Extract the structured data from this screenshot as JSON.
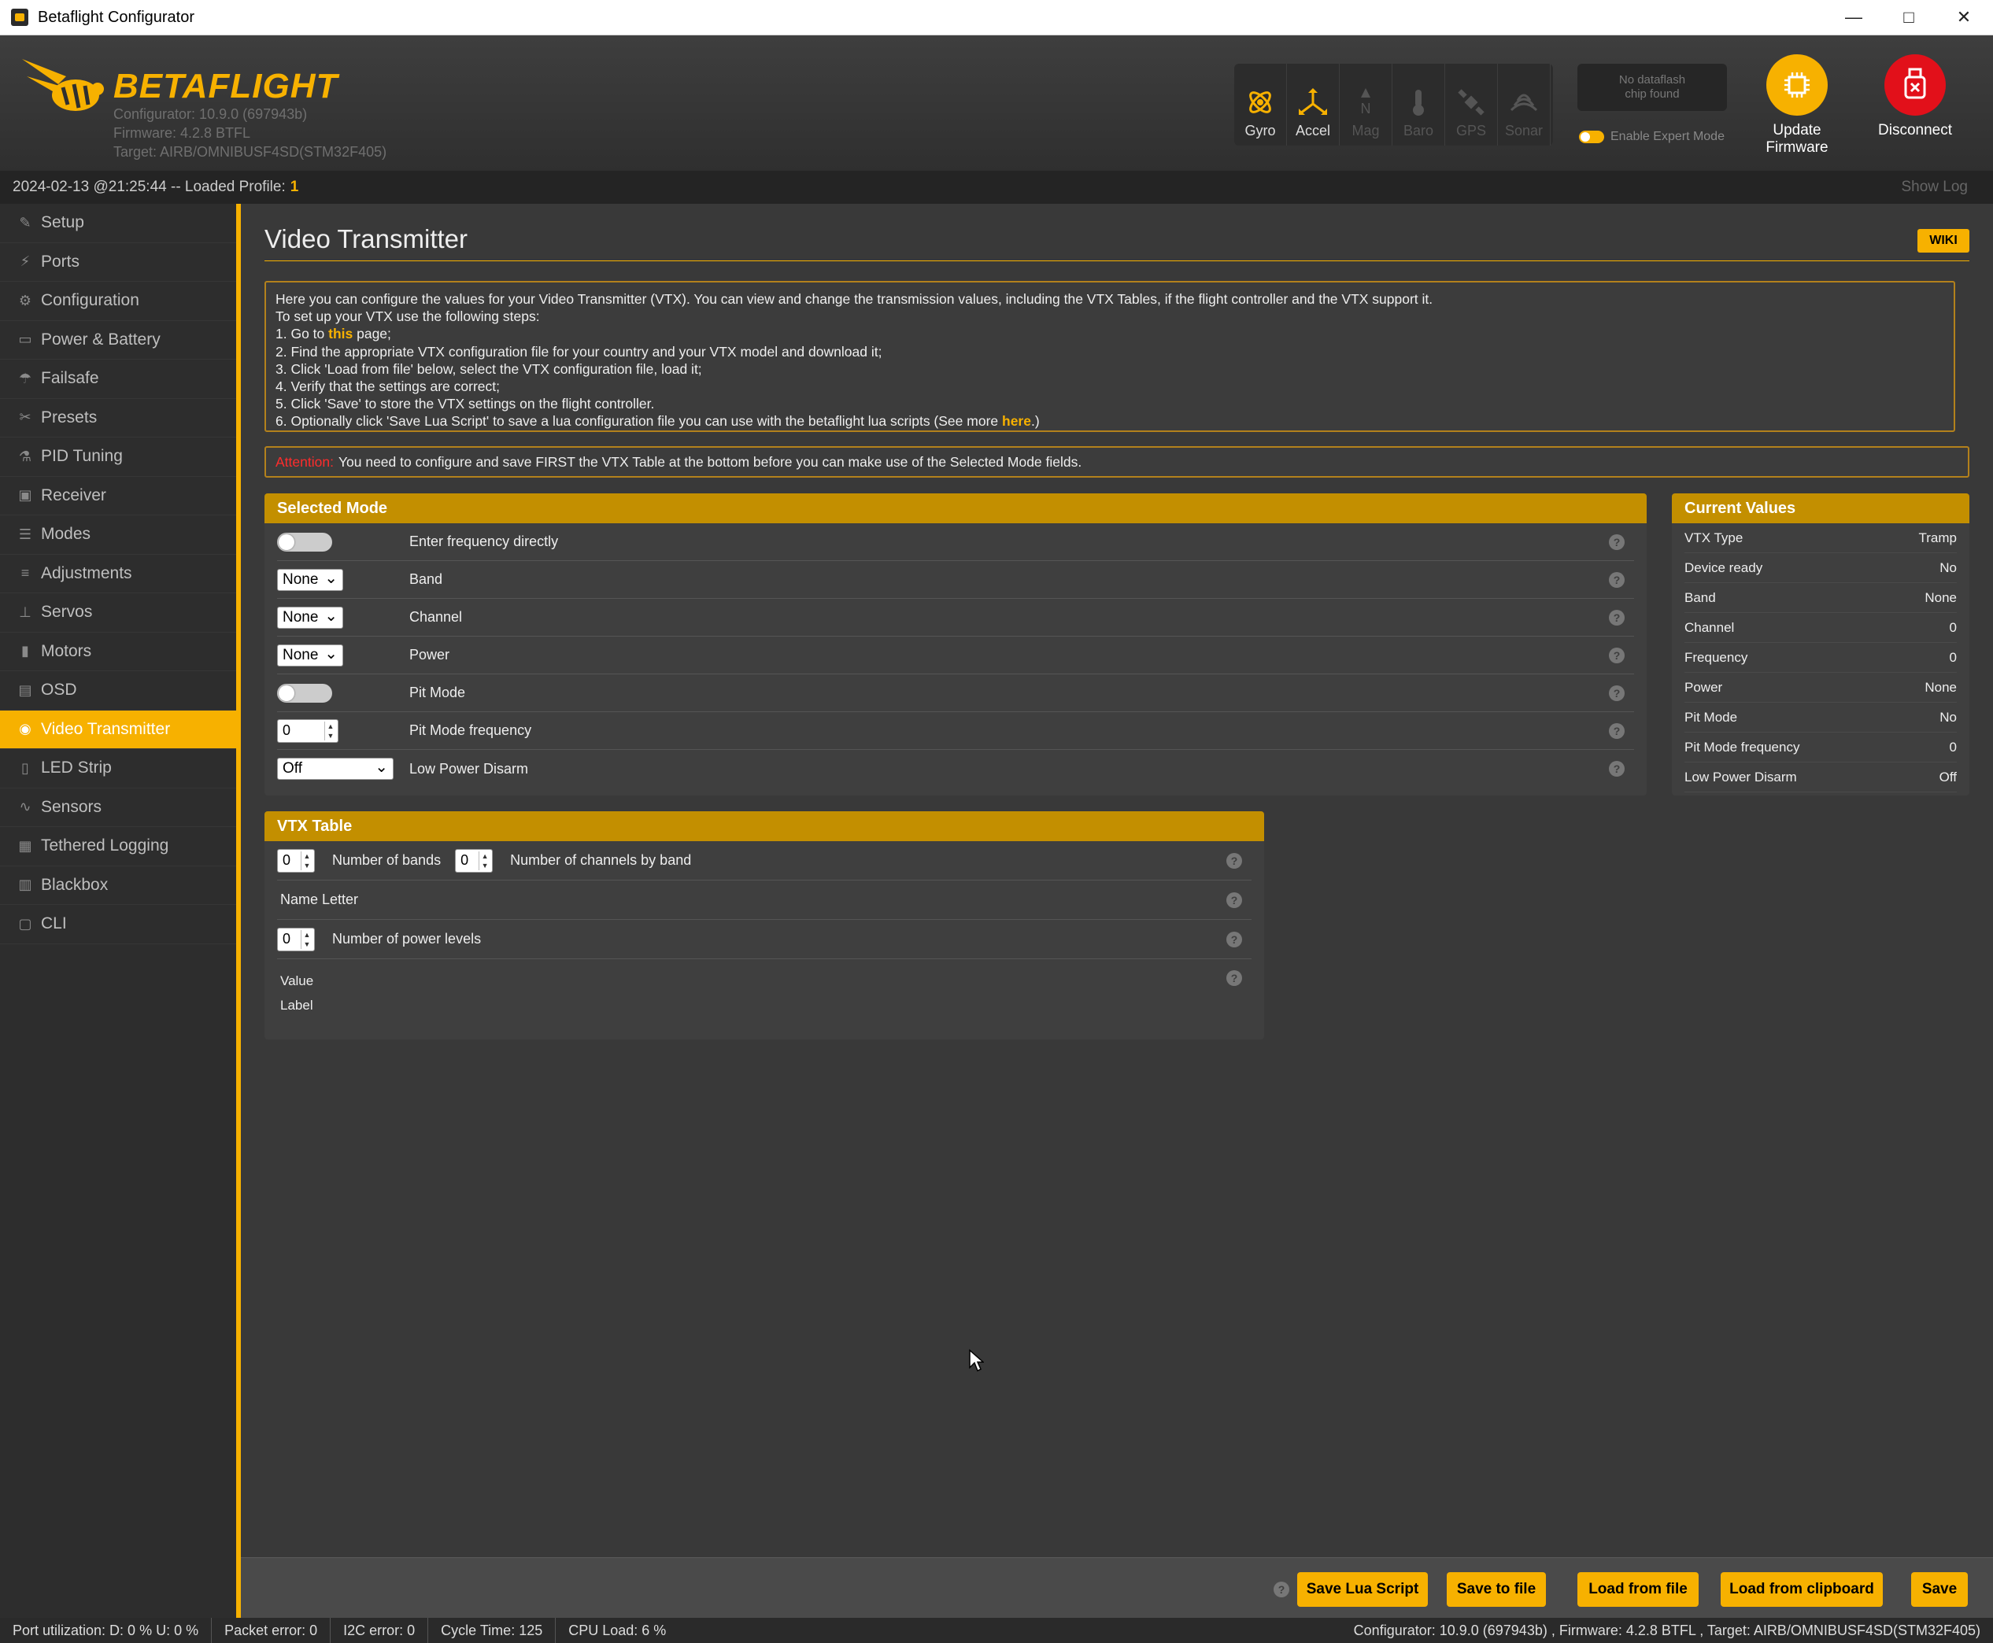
{
  "window": {
    "title": "Betaflight Configurator"
  },
  "header": {
    "logo_text": "BETAFLIGHT",
    "configurator_version": "Configurator: 10.9.0 (697943b)",
    "firmware": "Firmware: 4.2.8 BTFL",
    "target": "Target: AIRB/OMNIBUSF4SD(STM32F405)",
    "sensors": [
      {
        "label": "Gyro",
        "icon": "gyro-icon",
        "active": true
      },
      {
        "label": "Accel",
        "icon": "accel-icon",
        "active": true
      },
      {
        "label": "Mag",
        "icon": "mag-icon",
        "active": false
      },
      {
        "label": "Baro",
        "icon": "baro-icon",
        "active": false
      },
      {
        "label": "GPS",
        "icon": "gps-icon",
        "active": false
      },
      {
        "label": "Sonar",
        "icon": "sonar-icon",
        "active": false
      }
    ],
    "dataflash_line1": "No dataflash",
    "dataflash_line2": "chip found",
    "expert_mode_label": "Enable Expert Mode",
    "update_firmware_line1": "Update",
    "update_firmware_line2": "Firmware",
    "disconnect_label": "Disconnect"
  },
  "status": {
    "datetime": "2024-02-13 @21:25:44 -- Loaded Profile:",
    "profile": "1",
    "show_log": "Show Log"
  },
  "sidebar": {
    "items": [
      {
        "label": "Setup",
        "icon": "wrench-icon"
      },
      {
        "label": "Ports",
        "icon": "plug-icon"
      },
      {
        "label": "Configuration",
        "icon": "gear-icon"
      },
      {
        "label": "Power & Battery",
        "icon": "battery-icon"
      },
      {
        "label": "Failsafe",
        "icon": "parachute-icon"
      },
      {
        "label": "Presets",
        "icon": "presets-icon"
      },
      {
        "label": "PID Tuning",
        "icon": "pid-icon"
      },
      {
        "label": "Receiver",
        "icon": "receiver-icon"
      },
      {
        "label": "Modes",
        "icon": "modes-icon"
      },
      {
        "label": "Adjustments",
        "icon": "sliders-icon"
      },
      {
        "label": "Servos",
        "icon": "servo-icon"
      },
      {
        "label": "Motors",
        "icon": "motor-icon"
      },
      {
        "label": "OSD",
        "icon": "osd-icon"
      },
      {
        "label": "Video Transmitter",
        "icon": "vtx-icon",
        "active": true
      },
      {
        "label": "LED Strip",
        "icon": "led-icon"
      },
      {
        "label": "Sensors",
        "icon": "sensors-icon"
      },
      {
        "label": "Tethered Logging",
        "icon": "logging-icon"
      },
      {
        "label": "Blackbox",
        "icon": "blackbox-icon"
      },
      {
        "label": "CLI",
        "icon": "cli-icon"
      }
    ]
  },
  "main": {
    "title": "Video Transmitter",
    "wiki": "WIKI",
    "intro": {
      "line1": "Here you can configure the values for your Video Transmitter (VTX). You can view and change the transmission values, including the VTX Tables, if the flight controller and the VTX support it.",
      "line2": "To set up your VTX use the following steps:",
      "step1_a": "1. Go to ",
      "step1_link": "this",
      "step1_b": " page;",
      "step2": "2. Find the appropriate VTX configuration file for your country and your VTX model and download it;",
      "step3": "3. Click 'Load from file' below, select the VTX configuration file, load it;",
      "step4": "4. Verify that the settings are correct;",
      "step5": "5. Click 'Save' to store the VTX settings on the flight controller.",
      "step6_a": "6. Optionally click 'Save Lua Script' to save a lua configuration file you can use with the betaflight lua scripts (See more ",
      "step6_link": "here",
      "step6_b": ".)"
    },
    "attention": {
      "label": "Attention:",
      "text": "You need to configure and save FIRST the VTX Table at the bottom before you can make use of the Selected Mode fields."
    },
    "selected_mode": {
      "title": "Selected Mode",
      "enter_freq": "Enter frequency directly",
      "band_value": "None",
      "band_label": "Band",
      "channel_value": "None",
      "channel_label": "Channel",
      "power_value": "None",
      "power_label": "Power",
      "pit_mode": "Pit Mode",
      "pit_freq_value": "0",
      "pit_freq_label": "Pit Mode frequency",
      "lpd_value": "Off",
      "lpd_label": "Low Power Disarm"
    },
    "current_values": {
      "title": "Current Values",
      "rows": [
        {
          "label": "VTX Type",
          "value": "Tramp"
        },
        {
          "label": "Device ready",
          "value": "No"
        },
        {
          "label": "Band",
          "value": "None"
        },
        {
          "label": "Channel",
          "value": "0"
        },
        {
          "label": "Frequency",
          "value": "0"
        },
        {
          "label": "Power",
          "value": "None"
        },
        {
          "label": "Pit Mode",
          "value": "No"
        },
        {
          "label": "Pit Mode frequency",
          "value": "0"
        },
        {
          "label": "Low Power Disarm",
          "value": "Off"
        }
      ]
    },
    "vtx_table": {
      "title": "VTX Table",
      "bands_value": "0",
      "bands_label": "Number of bands",
      "channels_value": "0",
      "channels_label": "Number of channels by band",
      "name_letter": "Name Letter",
      "power_levels_value": "0",
      "power_levels_label": "Number of power levels",
      "value_label": "Value",
      "label_label": "Label"
    }
  },
  "toolbar": {
    "save_lua": "Save Lua Script",
    "save_file": "Save to file",
    "load_file": "Load from file",
    "load_clipboard": "Load from clipboard",
    "save": "Save"
  },
  "bottom": {
    "port_util": "Port utilization: D: 0 % U: 0 %",
    "packet_error": "Packet error: 0",
    "i2c_error": "I2C error: 0",
    "cycle_time": "Cycle Time: 125",
    "cpu_load": "CPU Load: 6 %",
    "version_info": "Configurator: 10.9.0 (697943b) , Firmware: 4.2.8 BTFL , Target: AIRB/OMNIBUSF4SD(STM32F405)"
  },
  "colors": {
    "accent": "#f7b100",
    "panel_head": "#c38f00",
    "disconnect": "#e2101a",
    "attention": "#ff2c2c"
  }
}
